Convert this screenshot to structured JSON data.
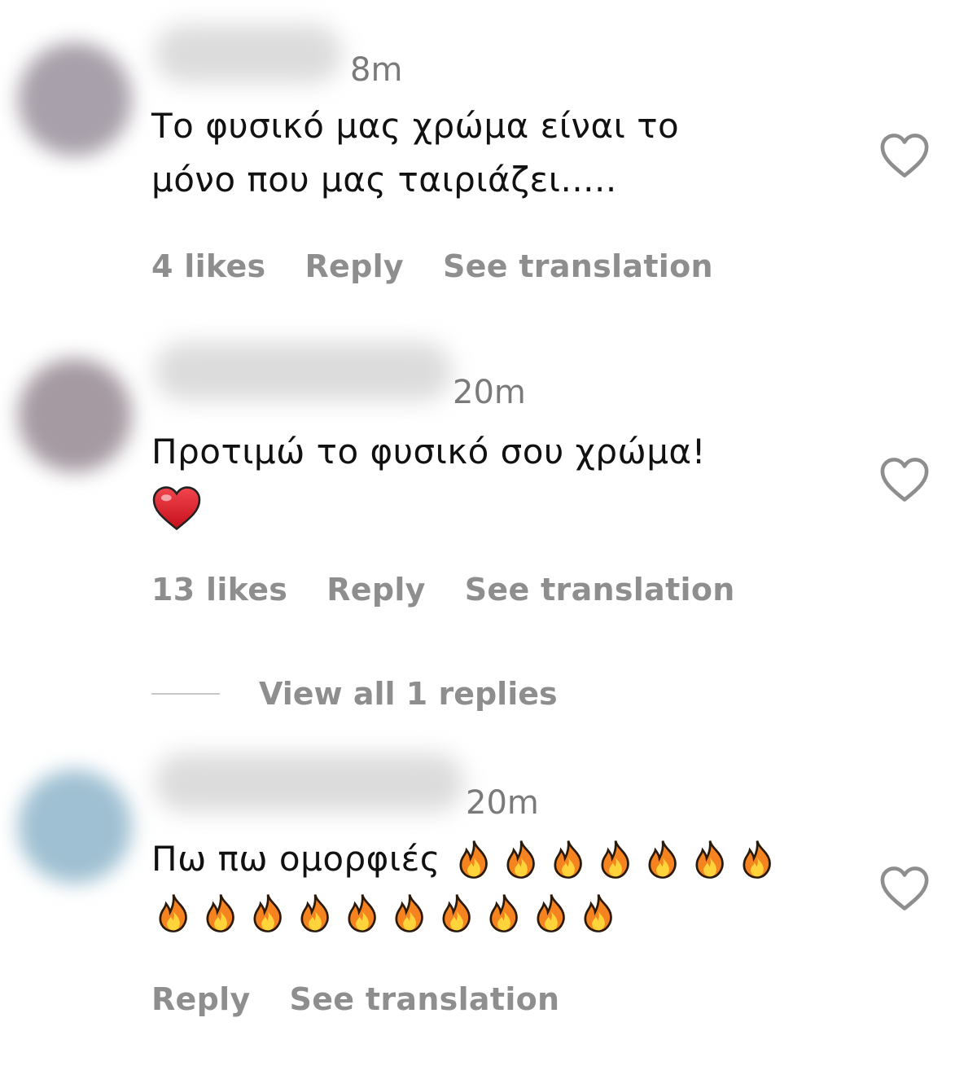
{
  "comments": [
    {
      "time": "8m",
      "text_lines": [
        "Το φυσικό μας χρώμα είναι το",
        "μόνο που μας ταιριάζει....."
      ],
      "likes": "4 likes",
      "reply": "Reply",
      "translate": "See translation"
    },
    {
      "time": "20m",
      "text_lines": [
        "Προτιμώ το φυσικό σου χρώμα!"
      ],
      "emoji": "heart",
      "likes": "13 likes",
      "reply": "Reply",
      "translate": "See translation"
    },
    {
      "time": "20m",
      "text_lines": [
        "Πω πω ομορφιές"
      ],
      "emoji": "fire",
      "emoji_counts": [
        7,
        10
      ],
      "reply": "Reply",
      "translate": "See translation"
    }
  ],
  "view_replies": "View all 1 replies",
  "icons": {
    "like": "heart-outline-icon",
    "heart_emoji": "red-heart-emoji",
    "fire_emoji": "fire-emoji"
  },
  "colors": {
    "secondary_text": "#8e8e8e",
    "primary_text": "#111111",
    "heart_red": "#e0202b",
    "fire_orange": "#f5831f"
  }
}
